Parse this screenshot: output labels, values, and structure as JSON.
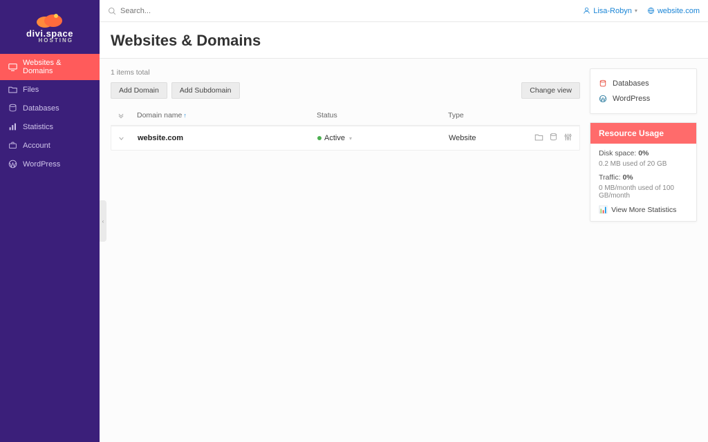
{
  "brand": {
    "name": "divi.space",
    "sub": "HOSTING"
  },
  "sidebar": {
    "items": [
      {
        "label": "Websites & Domains",
        "icon": "monitor"
      },
      {
        "label": "Files",
        "icon": "folder"
      },
      {
        "label": "Databases",
        "icon": "database"
      },
      {
        "label": "Statistics",
        "icon": "stats"
      },
      {
        "label": "Account",
        "icon": "briefcase"
      },
      {
        "label": "WordPress",
        "icon": "wordpress"
      }
    ]
  },
  "topbar": {
    "search_placeholder": "Search...",
    "user_name": "Lisa-Robyn",
    "site_name": "website.com"
  },
  "page": {
    "title": "Websites & Domains"
  },
  "list": {
    "total_text": "1 items total",
    "add_domain_label": "Add Domain",
    "add_subdomain_label": "Add Subdomain",
    "change_view_label": "Change view",
    "columns": {
      "name": "Domain name",
      "status": "Status",
      "type": "Type"
    },
    "rows": [
      {
        "name": "website.com",
        "status": "Active",
        "type": "Website"
      }
    ]
  },
  "quicklinks": [
    {
      "label": "Databases",
      "icon": "database"
    },
    {
      "label": "WordPress",
      "icon": "wordpress"
    }
  ],
  "resources": {
    "header": "Resource Usage",
    "disk_label": "Disk space:",
    "disk_pct": "0%",
    "disk_detail": "0.2 MB used of 20 GB",
    "traffic_label": "Traffic:",
    "traffic_pct": "0%",
    "traffic_detail": "0 MB/month used of 100 GB/month",
    "more_link": "View More Statistics"
  }
}
